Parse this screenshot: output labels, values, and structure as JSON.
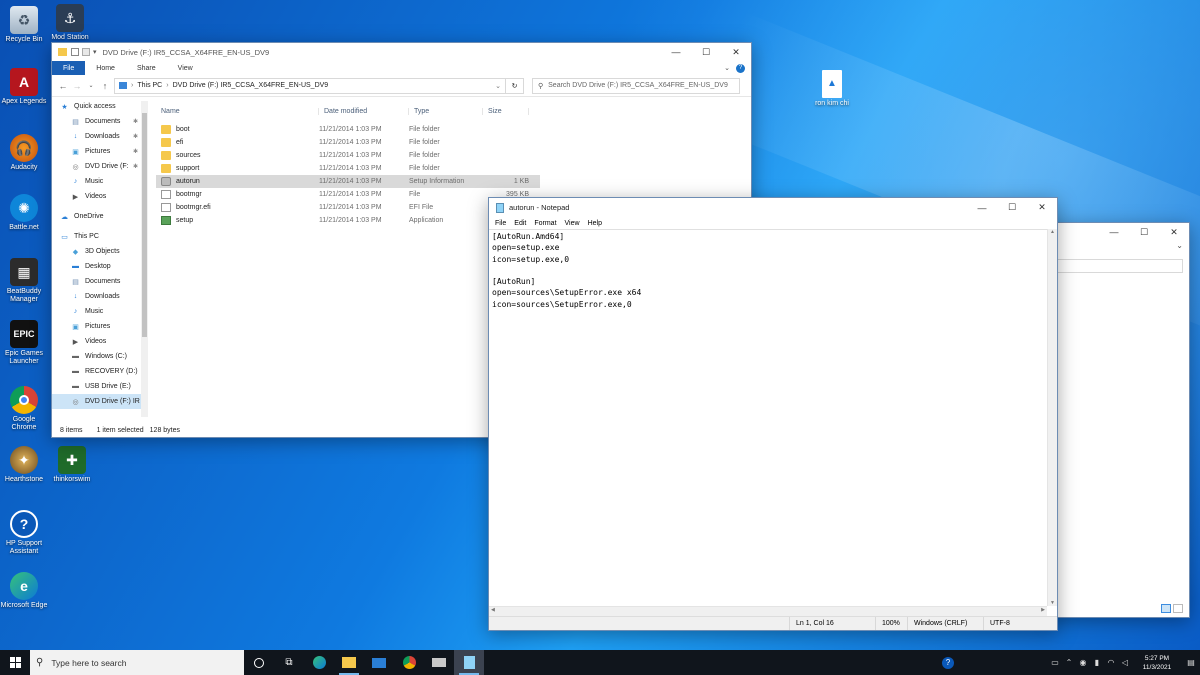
{
  "desktop": {
    "icons": [
      {
        "label": "Recycle Bin"
      },
      {
        "label": "Mod Station"
      },
      {
        "label": "Apex Legends"
      },
      {
        "label": "Audacity"
      },
      {
        "label": "Battle.net"
      },
      {
        "label": "BeatBuddy Manager"
      },
      {
        "label": "Epic Games Launcher"
      },
      {
        "label": "Google Chrome"
      },
      {
        "label": "Hearthstone"
      },
      {
        "label": "thinkorswim"
      },
      {
        "label": "HP Support Assistant"
      },
      {
        "label": "Microsoft Edge"
      },
      {
        "label": "ron kim chi"
      }
    ]
  },
  "explorer": {
    "title": "DVD Drive (F:) IR5_CCSA_X64FRE_EN-US_DV9",
    "ribbon_tabs": [
      "File",
      "Home",
      "Share",
      "View"
    ],
    "breadcrumb": [
      "This PC",
      "DVD Drive (F:) IR5_CCSA_X64FRE_EN-US_DV9"
    ],
    "search_placeholder": "Search DVD Drive (F:) IR5_CCSA_X64FRE_EN-US_DV9",
    "columns": [
      "Name",
      "Date modified",
      "Type",
      "Size"
    ],
    "nav": [
      {
        "label": "Quick access",
        "icon": "star-icon",
        "level": 0
      },
      {
        "label": "Documents",
        "icon": "document-icon",
        "level": 1
      },
      {
        "label": "Downloads",
        "icon": "download-icon",
        "level": 1
      },
      {
        "label": "Pictures",
        "icon": "picture-icon",
        "level": 1
      },
      {
        "label": "DVD Drive (F:",
        "icon": "disc-icon",
        "level": 1
      },
      {
        "label": "Music",
        "icon": "music-icon",
        "level": 1
      },
      {
        "label": "Videos",
        "icon": "video-icon",
        "level": 1
      },
      {
        "label": "OneDrive",
        "icon": "cloud-icon",
        "level": 0
      },
      {
        "label": "This PC",
        "icon": "computer-icon",
        "level": 0
      },
      {
        "label": "3D Objects",
        "icon": "cube-icon",
        "level": 1
      },
      {
        "label": "Desktop",
        "icon": "desktop-icon",
        "level": 1
      },
      {
        "label": "Documents",
        "icon": "document-icon",
        "level": 1
      },
      {
        "label": "Downloads",
        "icon": "download-icon",
        "level": 1
      },
      {
        "label": "Music",
        "icon": "music-icon",
        "level": 1
      },
      {
        "label": "Pictures",
        "icon": "picture-icon",
        "level": 1
      },
      {
        "label": "Videos",
        "icon": "video-icon",
        "level": 1
      },
      {
        "label": "Windows (C:)",
        "icon": "drive-icon",
        "level": 1
      },
      {
        "label": "RECOVERY (D:)",
        "icon": "drive-icon",
        "level": 1
      },
      {
        "label": "USB Drive (E:)",
        "icon": "usb-icon",
        "level": 1
      },
      {
        "label": "DVD Drive (F:) IR",
        "icon": "disc-icon",
        "level": 1
      }
    ],
    "files": [
      {
        "name": "boot",
        "date": "11/21/2014 1:03 PM",
        "type": "File folder",
        "size": "",
        "icon": "folder-icon"
      },
      {
        "name": "efi",
        "date": "11/21/2014 1:03 PM",
        "type": "File folder",
        "size": "",
        "icon": "folder-icon"
      },
      {
        "name": "sources",
        "date": "11/21/2014 1:03 PM",
        "type": "File folder",
        "size": "",
        "icon": "folder-icon"
      },
      {
        "name": "support",
        "date": "11/21/2014 1:03 PM",
        "type": "File folder",
        "size": "",
        "icon": "folder-icon"
      },
      {
        "name": "autorun",
        "date": "11/21/2014 1:03 PM",
        "type": "Setup Information",
        "size": "1 KB",
        "icon": "settings-file-icon"
      },
      {
        "name": "bootmgr",
        "date": "11/21/2014 1:03 PM",
        "type": "File",
        "size": "395 KB",
        "icon": "file-icon"
      },
      {
        "name": "bootmgr.efi",
        "date": "11/21/2014 1:03 PM",
        "type": "EFI File",
        "size": "",
        "icon": "file-icon"
      },
      {
        "name": "setup",
        "date": "11/21/2014 1:03 PM",
        "type": "Application",
        "size": "",
        "icon": "app-icon"
      }
    ],
    "status": {
      "items": "8 items",
      "selected": "1 item selected",
      "size": "128 bytes"
    }
  },
  "notepad": {
    "title": "autorun - Notepad",
    "menu": [
      "File",
      "Edit",
      "Format",
      "View",
      "Help"
    ],
    "lines": [
      "[AutoRun.Amd64]",
      "open=setup.exe",
      "icon=setup.exe,0",
      "",
      "[AutoRun]",
      "open=sources\\SetupError.exe x64",
      "icon=sources\\SetupError.exe,0"
    ],
    "status": {
      "position": "Ln 1, Col 16",
      "zoom": "100%",
      "line_ending": "Windows (CRLF)",
      "encoding": "UTF-8"
    }
  },
  "taskbar": {
    "search_placeholder": "Type here to search",
    "clock_time": "5:27 PM",
    "clock_date": "11/3/2021"
  }
}
